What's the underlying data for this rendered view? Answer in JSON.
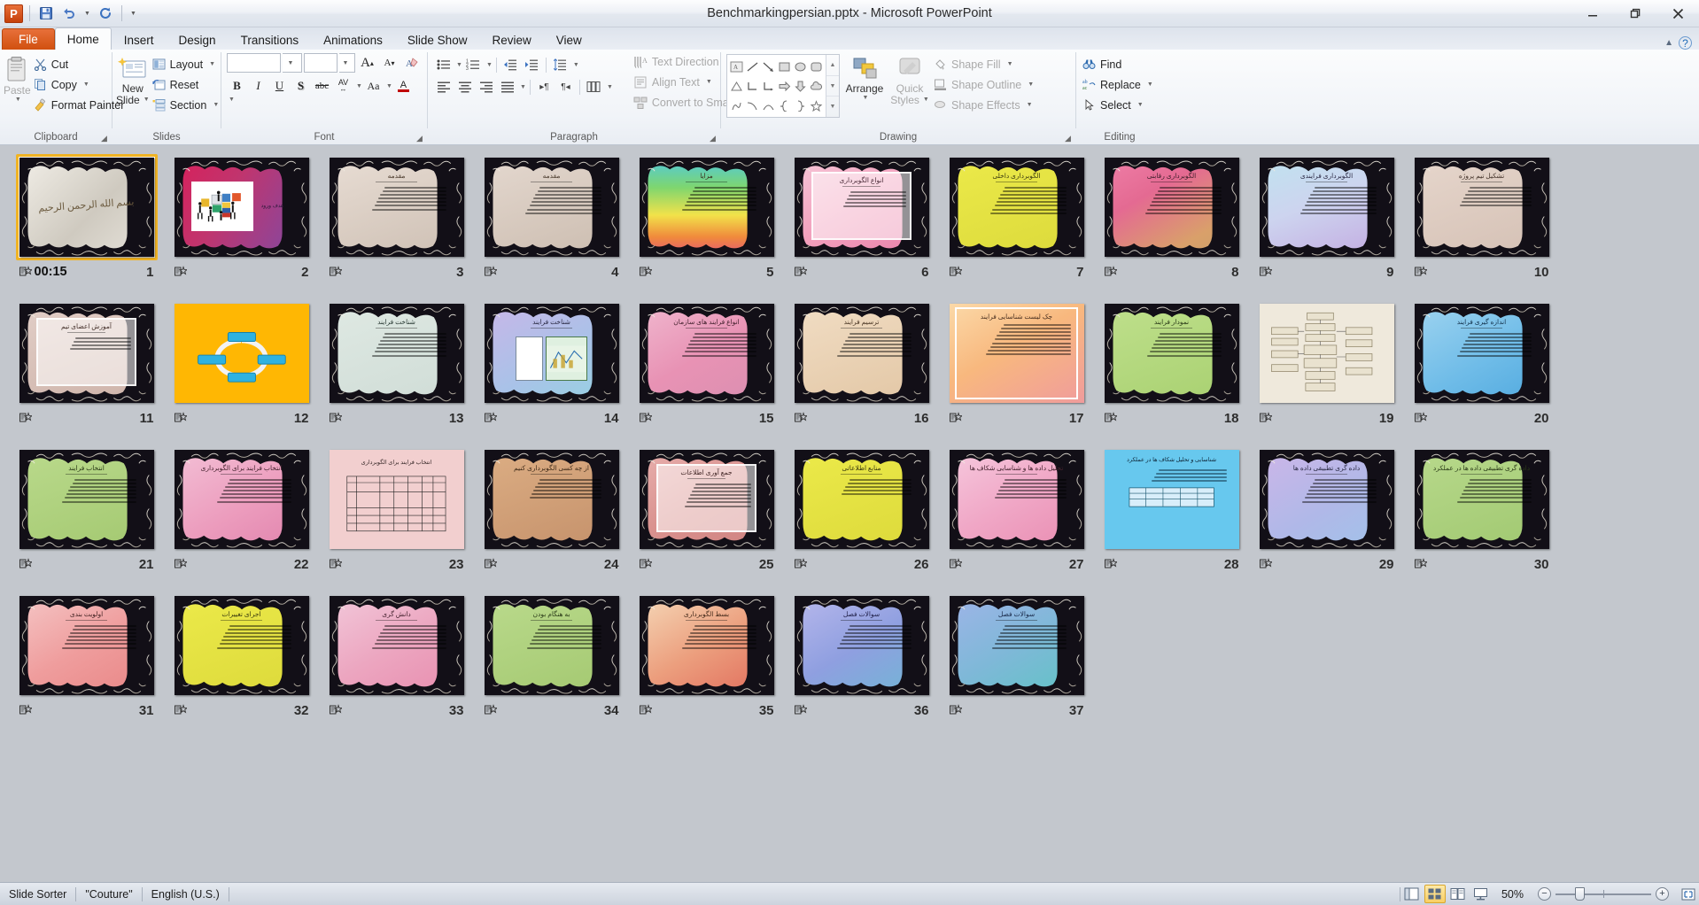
{
  "window": {
    "title": "Benchmarkingpersian.pptx - Microsoft PowerPoint",
    "minimize": "—",
    "restore": "❐",
    "close": "✕",
    "app_icon": "P"
  },
  "quick_access": {
    "save": "save-icon",
    "undo": "undo-icon",
    "redo": "redo-icon",
    "customize": "customize-icon"
  },
  "ribbon": {
    "tabs": [
      {
        "label": "File",
        "type": "file"
      },
      {
        "label": "Home",
        "type": "active"
      },
      {
        "label": "Insert",
        "type": "normal"
      },
      {
        "label": "Design",
        "type": "normal"
      },
      {
        "label": "Transitions",
        "type": "normal"
      },
      {
        "label": "Animations",
        "type": "normal"
      },
      {
        "label": "Slide Show",
        "type": "normal"
      },
      {
        "label": "Review",
        "type": "normal"
      },
      {
        "label": "View",
        "type": "normal"
      }
    ],
    "minimize_ribbon": "▲",
    "help": "?",
    "groups": {
      "clipboard": {
        "label": "Clipboard",
        "paste": "Paste",
        "cut": "Cut",
        "copy": "Copy",
        "format_painter": "Format Painter"
      },
      "slides": {
        "label": "Slides",
        "new_slide": "New\nSlide",
        "new_slide_line1": "New",
        "new_slide_line2": "Slide",
        "layout": "Layout",
        "reset": "Reset",
        "section": "Section"
      },
      "font": {
        "label": "Font",
        "font_name": "",
        "font_size": "",
        "grow": "A",
        "shrink": "A",
        "clear_formatting": "clear-format-icon",
        "bold": "B",
        "italic": "I",
        "underline": "U",
        "shadow": "S",
        "strikethrough": "abc",
        "character_spacing": "AV",
        "change_case": "Aa",
        "font_color": "A"
      },
      "paragraph": {
        "label": "Paragraph",
        "bullets": "bullets-icon",
        "numbering": "numbering-icon",
        "decrease_indent": "decrease-indent-icon",
        "increase_indent": "increase-indent-icon",
        "line_spacing": "line-spacing-icon",
        "align_left": "align-left-icon",
        "center": "align-center-icon",
        "align_right": "align-right-icon",
        "justify": "justify-icon",
        "ltr": "ltr-icon",
        "rtl": "rtl-icon",
        "columns": "columns-icon",
        "text_direction": "Text Direction",
        "align_text": "Align Text",
        "convert_smartart": "Convert to SmartArt"
      },
      "drawing": {
        "label": "Drawing",
        "arrange": "Arrange",
        "quick_styles_line1": "Quick",
        "quick_styles_line2": "Styles",
        "shape_fill": "Shape Fill",
        "shape_outline": "Shape Outline",
        "shape_effects": "Shape Effects"
      },
      "editing": {
        "label": "Editing",
        "find": "Find",
        "replace": "Replace",
        "select": "Select"
      }
    }
  },
  "status_bar": {
    "view_name": "Slide Sorter",
    "theme": "\"Couture\"",
    "language": "English (U.S.)",
    "zoom_level": "50%",
    "views": [
      {
        "name": "normal-view-button",
        "glyph": "normal",
        "active": false
      },
      {
        "name": "slide-sorter-view-button",
        "glyph": "sorter",
        "active": true
      },
      {
        "name": "reading-view-button",
        "glyph": "reading",
        "active": false
      },
      {
        "name": "slide-show-button",
        "glyph": "show",
        "active": false
      }
    ],
    "zoom_out": "−",
    "zoom_in": "+",
    "fit_to_window": "fit-window-icon"
  },
  "slides": [
    {
      "n": "1",
      "title": "",
      "time": "00:15",
      "selected": true,
      "bg": "linear-gradient(135deg,#f2efe8,#cfcac0 55%,#e8e4dc)",
      "text": "#6b5a3e",
      "kind": "title",
      "titleText": "بسم الله الرحمن الرحیم"
    },
    {
      "n": "2",
      "title": "هدف ورود",
      "time": "",
      "bg": "linear-gradient(120deg,#d81f5a,#c0356e 40%,#7b4ba8)",
      "text": "#2b1a3a",
      "kind": "picture"
    },
    {
      "n": "3",
      "title": "مقدمه",
      "time": "",
      "bg": "linear-gradient(160deg,#e8ddd4,#cdbfb3)",
      "text": "#4a3a2c",
      "kind": "text",
      "lines": 7
    },
    {
      "n": "4",
      "title": "مقدمه",
      "time": "",
      "bg": "linear-gradient(160deg,#e4d8cf,#cbbcaf)",
      "text": "#4a3a2c",
      "kind": "text",
      "lines": 8
    },
    {
      "n": "5",
      "title": "مزایا",
      "time": "",
      "bg": "linear-gradient(180deg,#4fc8e0,#7ed66f 30%,#f2e24a 58%,#f08a3c 80%,#e3547a)",
      "text": "#3a2a1a",
      "kind": "text",
      "lines": 7
    },
    {
      "n": "6",
      "title": "انواع الگوبرداری",
      "time": "",
      "bg": "linear-gradient(150deg,#f6c8d8,#f2a0bd 50%,#e87fa8)",
      "text": "#4a2a38",
      "kind": "boxed",
      "lines": 5
    },
    {
      "n": "7",
      "title": "الگوبرداری داخلی",
      "time": "",
      "bg": "linear-gradient(160deg,#ecea4a,#dbd93a)",
      "text": "#3a3a10",
      "kind": "text",
      "lines": 8
    },
    {
      "n": "8",
      "title": "الگوبرداری رقابتی",
      "time": "",
      "bg": "linear-gradient(150deg,#ef7fa8,#e46a92 35%,#d9a06a 75%,#c8a06a)",
      "text": "#40202c",
      "kind": "text",
      "lines": 8
    },
    {
      "n": "9",
      "title": "الگوبرداری فرایندی",
      "time": "",
      "bg": "linear-gradient(160deg,#bfe3ef,#cdd4ef 45%,#c2a8e0)",
      "text": "#2c2a44",
      "kind": "text",
      "lines": 8
    },
    {
      "n": "10",
      "title": "تشکیل تیم پروژه",
      "time": "",
      "bg": "linear-gradient(160deg,#e6d6cc,#d4c0b4)",
      "text": "#44332a",
      "kind": "text",
      "lines": 6
    },
    {
      "n": "11",
      "title": "آموزش اعضای تیم",
      "time": "",
      "bg": "linear-gradient(160deg,#e2cfc8,#cdb2a8)",
      "text": "#44302a",
      "kind": "boxed",
      "lines": 4
    },
    {
      "n": "12",
      "title": "",
      "time": "",
      "bg": "#ffb703",
      "text": "#2c2c2c",
      "kind": "smartart"
    },
    {
      "n": "13",
      "title": "شناخت فرایند",
      "time": "",
      "bg": "linear-gradient(160deg,#dfe9e3,#cfdcd6)",
      "text": "#2a3a34",
      "kind": "text",
      "lines": 7
    },
    {
      "n": "14",
      "title": "شناخت فرایند",
      "time": "",
      "bg": "linear-gradient(150deg,#c9b6e8,#a9c2e8 55%,#93d4e0)",
      "text": "#2a2a44",
      "kind": "chartimg"
    },
    {
      "n": "15",
      "title": "انواع فرایند های سازمان",
      "time": "",
      "bg": "linear-gradient(150deg,#f0b8cf,#e892b4 50%,#d98fb0)",
      "text": "#44222e",
      "kind": "text",
      "lines": 7
    },
    {
      "n": "16",
      "title": "ترسیم فرایند",
      "time": "",
      "bg": "linear-gradient(160deg,#f1ddc4,#e2c6a4)",
      "text": "#4a3624",
      "kind": "text",
      "lines": 7
    },
    {
      "n": "17",
      "title": "چک لیست شناسایی فرایند",
      "time": "",
      "bg": "linear-gradient(150deg,#fbd9a8,#f8b87e 45%,#f09c9c)",
      "text": "#4a3020",
      "kind": "plain",
      "lines": 9
    },
    {
      "n": "18",
      "title": "نمودار فرایند",
      "time": "",
      "bg": "linear-gradient(160deg,#bfe08c,#a8d070)",
      "text": "#2a3a18",
      "kind": "text",
      "lines": 7
    },
    {
      "n": "19",
      "title": "",
      "time": "",
      "bg": "#efe9dc",
      "text": "#333",
      "kind": "flowchart"
    },
    {
      "n": "20",
      "title": "اندازه گیری فرایند",
      "time": "",
      "bg": "linear-gradient(150deg,#9fd4f0,#6fbce8 55%,#4fa8de)",
      "text": "#12304a",
      "kind": "text",
      "lines": 7
    },
    {
      "n": "21",
      "title": "انتخاب فرایند",
      "time": "",
      "bg": "linear-gradient(160deg,#bada8c,#a3c870)",
      "text": "#2a3a18",
      "kind": "text",
      "lines": 7
    },
    {
      "n": "22",
      "title": "انتخاب فرایند برای الگوبرداری",
      "time": "",
      "bg": "linear-gradient(150deg,#f3c0d6,#ec9cbd 55%,#e082ac)",
      "text": "#44222e",
      "kind": "text",
      "lines": 7
    },
    {
      "n": "23",
      "title": "انتخاب فرایند برای الگوبرداری",
      "time": "",
      "bg": "#f2cfcf",
      "text": "#3a2a2a",
      "kind": "table"
    },
    {
      "n": "24",
      "title": "از چه کسی الگوبرداری کنیم",
      "time": "",
      "bg": "linear-gradient(160deg,#dcae84,#c4906a)",
      "text": "#3e2a18",
      "kind": "text",
      "lines": 6
    },
    {
      "n": "25",
      "title": "جمع آوری اطلاعات",
      "time": "",
      "bg": "linear-gradient(150deg,#e8b0ae,#d9918e 50%,#cf8280)",
      "text": "#402424",
      "kind": "boxed",
      "lines": 7
    },
    {
      "n": "26",
      "title": "منابع اطلاعاتی",
      "time": "",
      "bg": "linear-gradient(160deg,#ecea4a,#dcd93a)",
      "text": "#3a3a10",
      "kind": "text",
      "lines": 5
    },
    {
      "n": "27",
      "title": "تحلیل داده ها و شناسایی شکاف ها",
      "time": "",
      "bg": "linear-gradient(150deg,#f6c9de,#f0a7c6 50%,#e88bb0)",
      "text": "#44222e",
      "kind": "text",
      "lines": 6
    },
    {
      "n": "28",
      "title": "شناسایی و تحلیل شکاف ها در عملکرد",
      "time": "",
      "bg": "#67c8ee",
      "text": "#10283a",
      "kind": "bluetable"
    },
    {
      "n": "29",
      "title": "داده گری تطبیقی داده ها",
      "time": "",
      "bg": "linear-gradient(150deg,#cdb6e8,#b0b8e8 55%,#9fc4ea)",
      "text": "#2a2a44",
      "kind": "text",
      "lines": 7
    },
    {
      "n": "30",
      "title": "داده گری تطبیقی داده ها در عملکرد",
      "time": "",
      "bg": "linear-gradient(160deg,#b8d98c,#a0c870)",
      "text": "#2a3a18",
      "kind": "text",
      "lines": 7
    },
    {
      "n": "31",
      "title": "اولویت بندی",
      "time": "",
      "bg": "linear-gradient(150deg,#f5c6c6,#ef9d9d 50%,#e88585)",
      "text": "#442424",
      "kind": "text",
      "lines": 7
    },
    {
      "n": "32",
      "title": "اجرای تغییرات",
      "time": "",
      "bg": "linear-gradient(160deg,#ecea4a,#dcd93a)",
      "text": "#3a3a10",
      "kind": "text",
      "lines": 7
    },
    {
      "n": "33",
      "title": "دانش گری",
      "time": "",
      "bg": "linear-gradient(150deg,#f2c8da,#eca6c0 50%,#e88cae)",
      "text": "#44222e",
      "kind": "text",
      "lines": 7
    },
    {
      "n": "34",
      "title": "به هنگام بودن",
      "time": "",
      "bg": "linear-gradient(160deg,#bada8c,#a3c870)",
      "text": "#2a3a18",
      "kind": "text",
      "lines": 7
    },
    {
      "n": "35",
      "title": "بسط الگوبرداری",
      "time": "",
      "bg": "linear-gradient(150deg,#f5d8b8,#ec9f7e 50%,#e06a5a)",
      "text": "#442a1a",
      "kind": "text",
      "lines": 7
    },
    {
      "n": "36",
      "title": "سوالات فصل",
      "time": "",
      "bg": "linear-gradient(150deg,#b8b8ec,#8f9fe0 50%,#6fb8d4)",
      "text": "#22224a",
      "kind": "text",
      "lines": 7
    },
    {
      "n": "37",
      "title": "سوالات فصل",
      "time": "",
      "bg": "linear-gradient(150deg,#9fb4e8,#7fb8d8 50%,#5fc4c4)",
      "text": "#1a2a4a",
      "kind": "text",
      "lines": 7
    }
  ]
}
